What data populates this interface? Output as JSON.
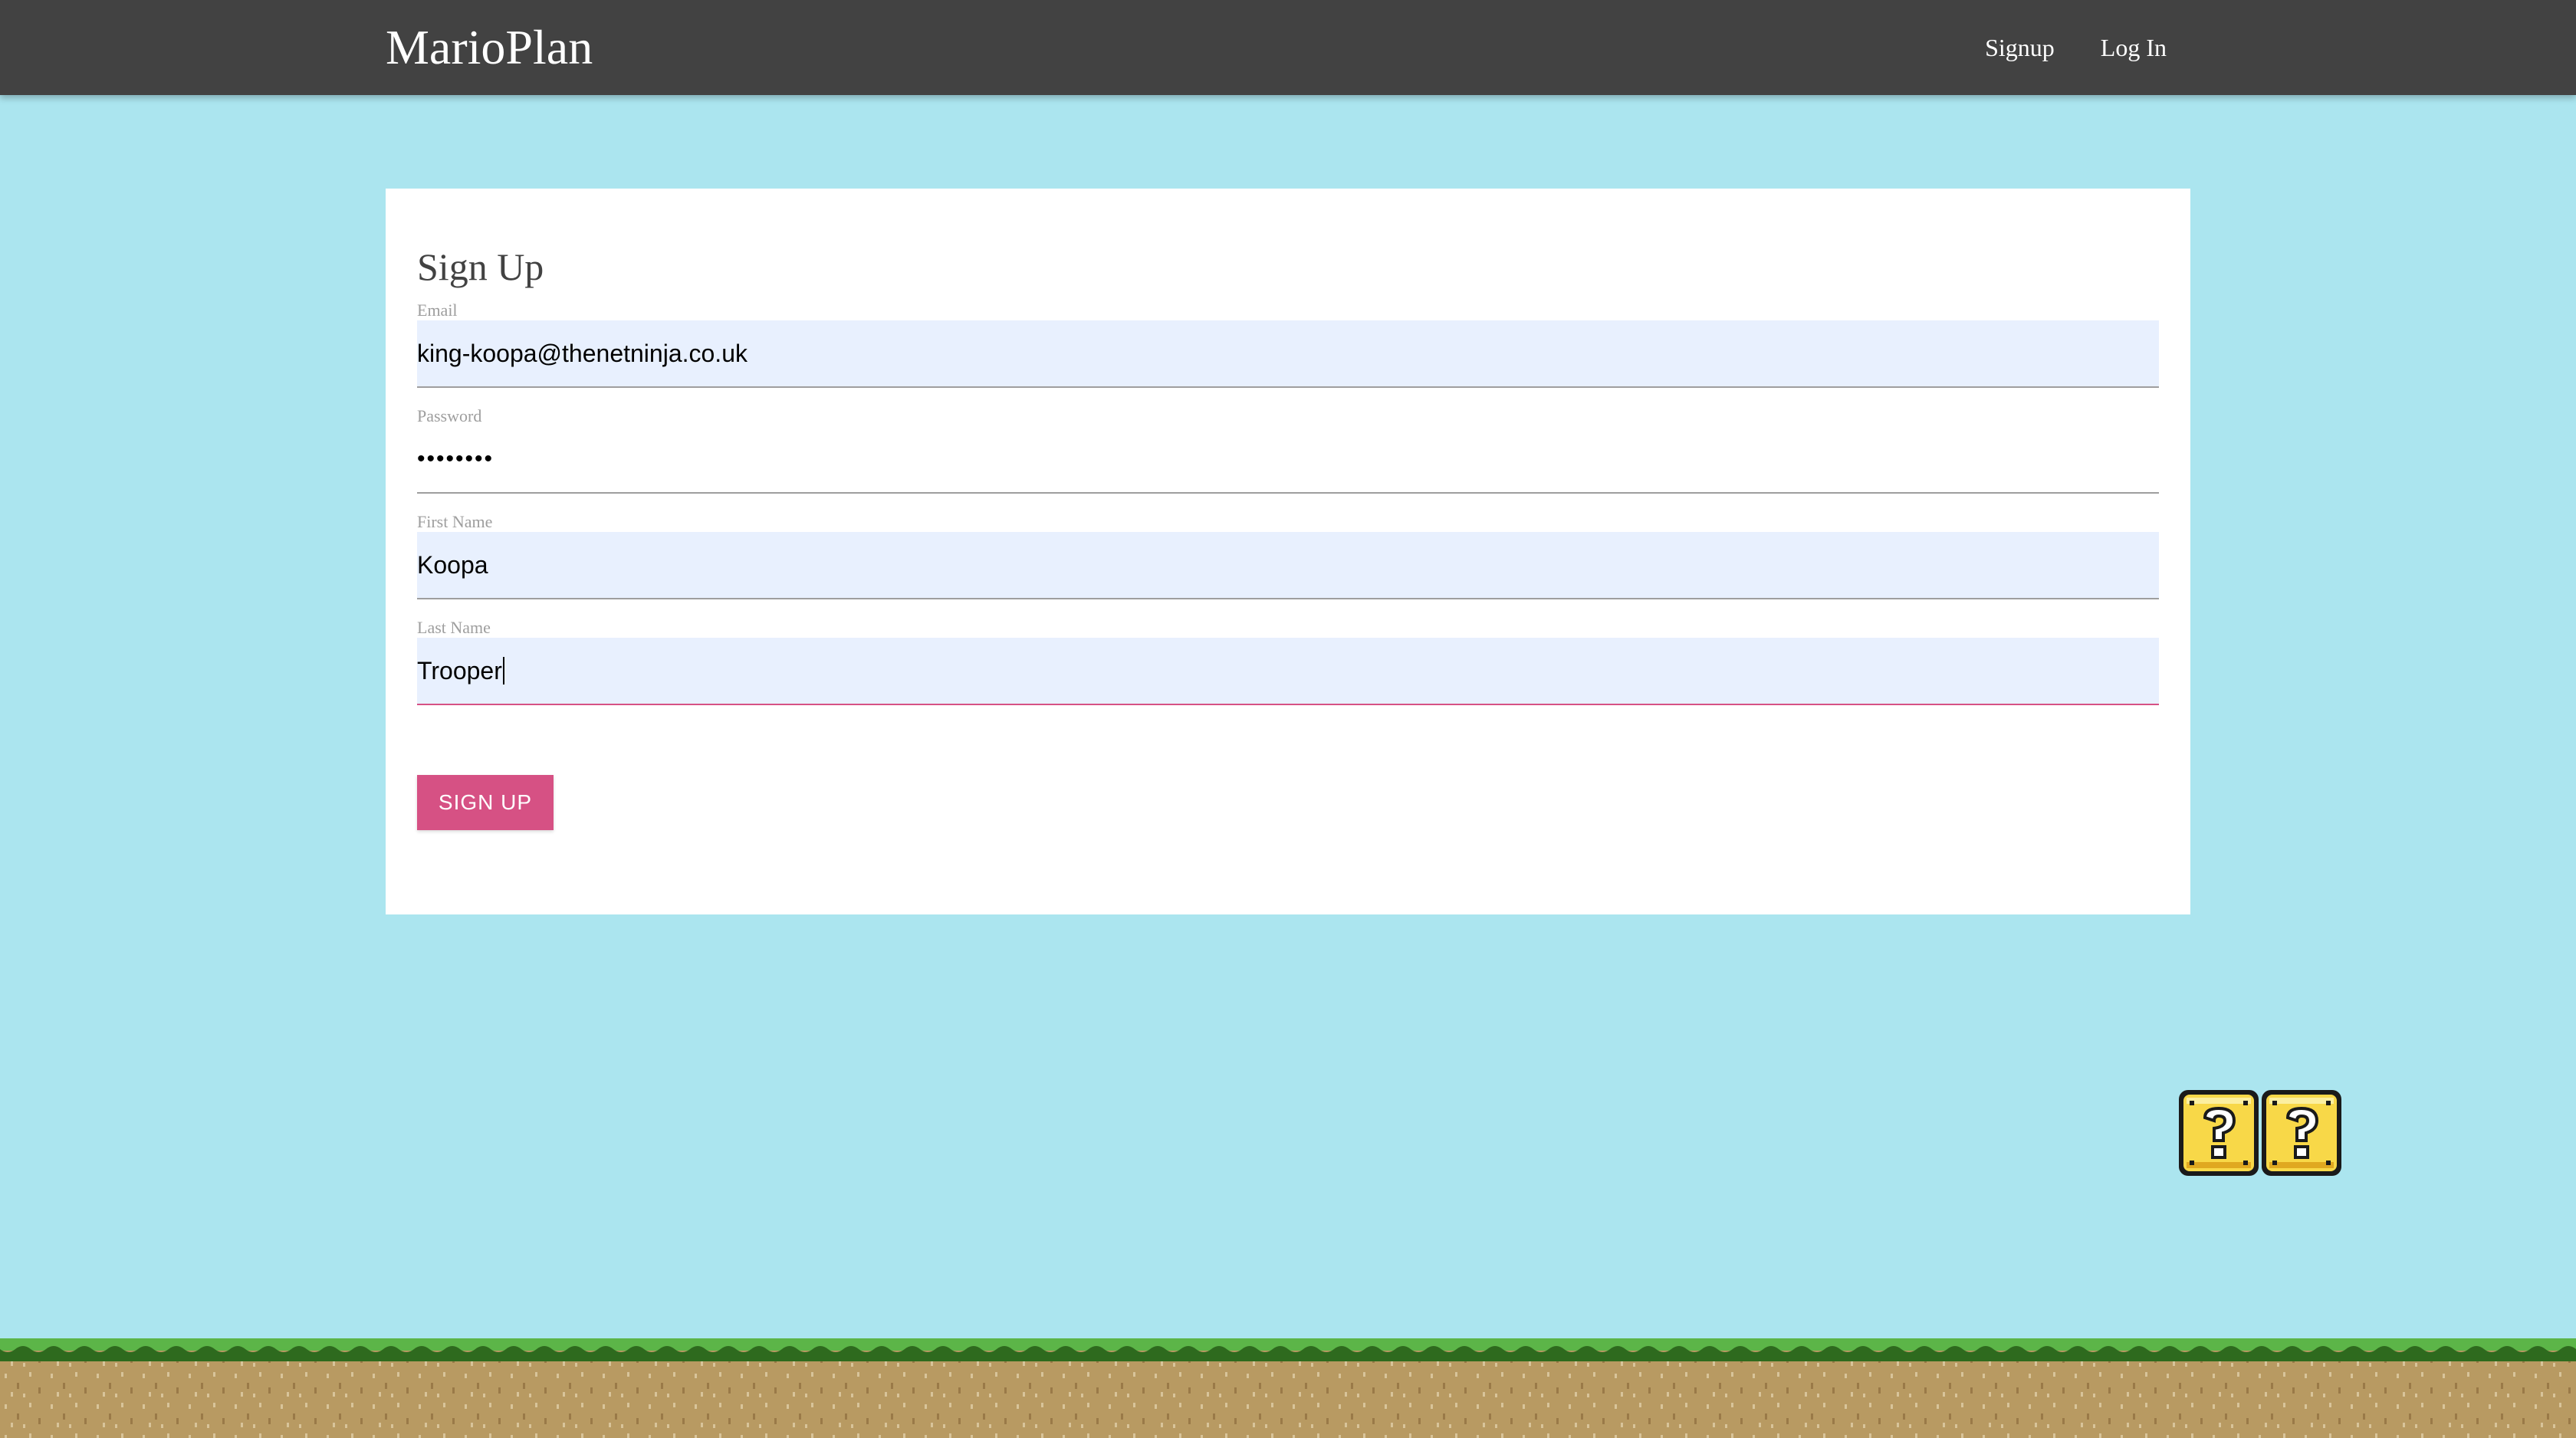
{
  "navbar": {
    "brand": "MarioPlan",
    "links": [
      {
        "label": "Signup"
      },
      {
        "label": "Log In"
      }
    ],
    "background": "#424242"
  },
  "form": {
    "title": "Sign Up",
    "fields": [
      {
        "label": "Email",
        "value": "king-koopa@thenetninja.co.uk",
        "type": "email"
      },
      {
        "label": "Password",
        "value": "••••••••",
        "type": "password"
      },
      {
        "label": "First Name",
        "value": "Koopa",
        "type": "text"
      },
      {
        "label": "Last Name",
        "value": "Trooper",
        "type": "text"
      }
    ],
    "submit_label": "Sign Up"
  },
  "colors": {
    "sky": "#ABE5EF",
    "accent": "#d65184",
    "autofill": "#E8F0FE"
  },
  "decorations": {
    "question_blocks": [
      "question-block-icon",
      "question-block-icon"
    ],
    "ground": "grass-ground"
  }
}
